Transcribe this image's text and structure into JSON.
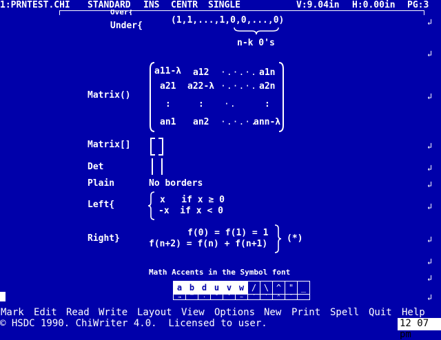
{
  "status": {
    "filename": "1:PRNTEST.CHI",
    "style": "STANDARD",
    "insert_mode": "INS",
    "align": "CENTR",
    "spacing": "SINGLE",
    "vpos": "V:9.04in",
    "hpos": "H:0.00in",
    "page": "PG:3"
  },
  "doc": {
    "over_partial": "Over{",
    "under_label": "Under{",
    "under_expr": "(1,1,...,1,0,0,...,0)",
    "under_note": "n-k 0's",
    "matrix_label": "Matrix()",
    "matrix_rows": [
      [
        "a11-λ",
        "a12",
        "·.·.·.",
        "a1n"
      ],
      [
        "a21",
        "a22-λ",
        "·.·.·.",
        "a2n"
      ],
      [
        ":",
        ":",
        "·.",
        ":"
      ],
      [
        "an1",
        "an2",
        "·.·.·.",
        "ann-λ"
      ]
    ],
    "matrix_sq_label": "Matrix[]",
    "det_label": "Det",
    "plain_label": "Plain",
    "plain_text": "No borders",
    "left_label": "Left{",
    "left_line1": "x   if x ≥ 0",
    "left_line2": "-x  if x < 0",
    "right_label": "Right}",
    "right_line1": "f(0) = f(1) = 1",
    "right_line2": "f(n+2) = f(n) + f(n+1)",
    "right_tag": "(*)",
    "accents_title": "Math Accents in the Symbol font",
    "accent_keys": [
      "a",
      "b",
      "d",
      "u",
      "v",
      "w",
      "/",
      "\\",
      "^",
      "\"",
      "_"
    ],
    "accent_marks": [
      "→",
      "‾",
      "·",
      "˘",
      "ˇ",
      "~",
      "´",
      "`",
      "^",
      "¨",
      "_"
    ]
  },
  "menu": [
    "Mark",
    "Edit",
    "Read",
    "Write",
    "Layout",
    "View",
    "Options",
    "New",
    "Print",
    "Spell",
    "Quit",
    "Help"
  ],
  "footer": {
    "copyright": "© HSDC 1990. ChiWriter 4.0.  Licensed to user.",
    "clock": "12 07 pm"
  },
  "colors": {
    "background": "#0000aa",
    "text": "#ffffff"
  }
}
